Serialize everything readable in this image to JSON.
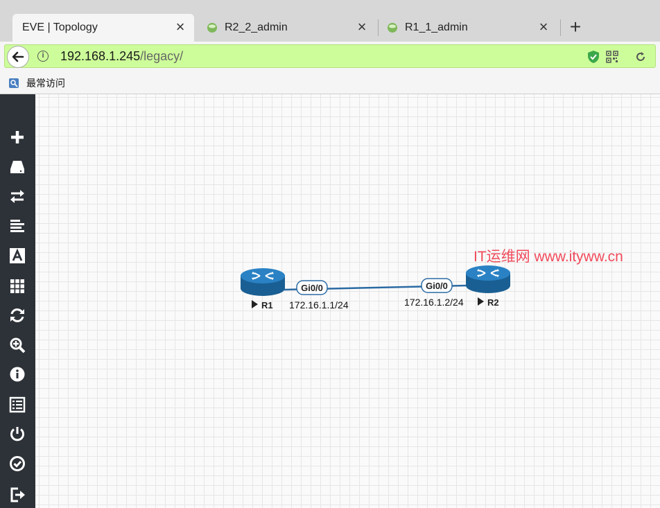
{
  "browser": {
    "tabs": [
      {
        "label": "EVE | Topology",
        "active": true
      },
      {
        "label": "R2_2_admin",
        "active": false
      },
      {
        "label": "R1_1_admin",
        "active": false
      }
    ],
    "new_tab_symbol": "+",
    "url_host": "192.168.1.245",
    "url_path": "/legacy/",
    "bookmark_label": "最常访问"
  },
  "sidebar": {
    "items": [
      {
        "icon": "plus-icon"
      },
      {
        "icon": "drive-icon"
      },
      {
        "icon": "transfer-icon"
      },
      {
        "icon": "align-left-icon"
      },
      {
        "icon": "font-icon"
      },
      {
        "icon": "grid-icon"
      },
      {
        "icon": "refresh-icon"
      },
      {
        "icon": "zoom-icon"
      },
      {
        "icon": "info-icon"
      },
      {
        "icon": "list-icon"
      },
      {
        "icon": "power-icon"
      },
      {
        "icon": "check-circle-icon"
      },
      {
        "icon": "sign-out-icon"
      }
    ]
  },
  "topology": {
    "nodes": [
      {
        "name": "R1",
        "ip": "172.16.1.1/24",
        "interface": "Gi0/0"
      },
      {
        "name": "R2",
        "ip": "172.16.1.2/24",
        "interface": "Gi0/0"
      }
    ],
    "link_color": "#2b6aa3",
    "router_color": "#1d6aa3"
  },
  "watermark": "IT运维网 www.ityww.cn"
}
